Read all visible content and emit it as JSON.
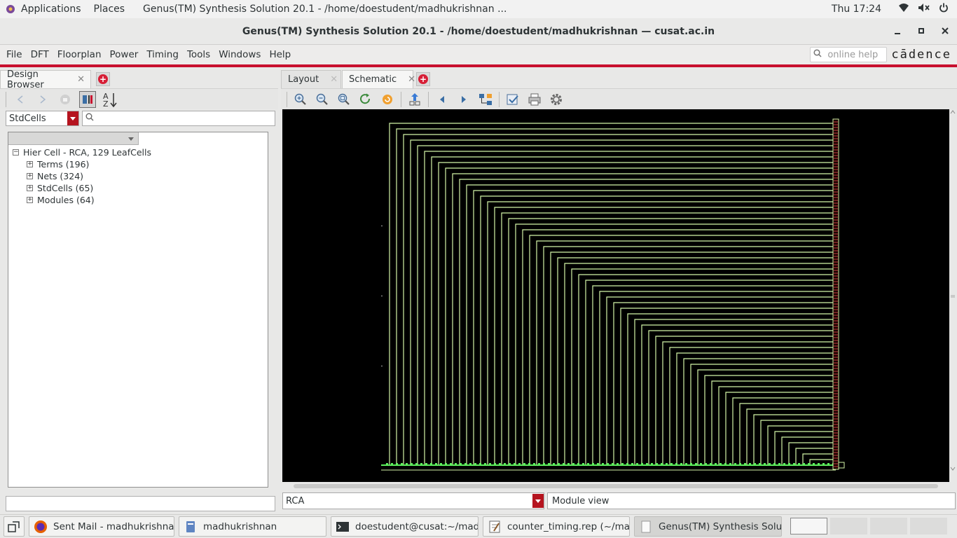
{
  "topbar": {
    "applications": "Applications",
    "places": "Places",
    "window_title": "Genus(TM) Synthesis Solution 20.1 - /home/doestudent/madhukrishnan ...",
    "clock": "Thu 17:24"
  },
  "window": {
    "title": "Genus(TM) Synthesis Solution 20.1 - /home/doestudent/madhukrishnan — cusat.ac.in"
  },
  "menubar": {
    "items": [
      "File",
      "DFT",
      "Floorplan",
      "Power",
      "Timing",
      "Tools",
      "Windows",
      "Help"
    ],
    "help_placeholder": "online help",
    "logo": "cādence"
  },
  "left_panel": {
    "tab": "Design Browser",
    "cell_type": "StdCells",
    "tree": {
      "root": "Hier Cell - RCA, 129 LeafCells",
      "children": [
        "Terms (196)",
        "Nets (324)",
        "StdCells (65)",
        "Modules (64)"
      ]
    }
  },
  "right_panel": {
    "tabs": [
      "Layout",
      "Schematic"
    ],
    "module": "RCA",
    "view_label": "Module view",
    "wire_color": "#d4f5a8",
    "pin_color": "#5ef05e"
  },
  "taskbar": {
    "tasks": [
      "Sent Mail - madhukrishnan...",
      "madhukrishnan",
      "doestudent@cusat:~/madh...",
      "counter_timing.rep (~/mad...",
      "Genus(TM) Synthesis Solut..."
    ]
  }
}
